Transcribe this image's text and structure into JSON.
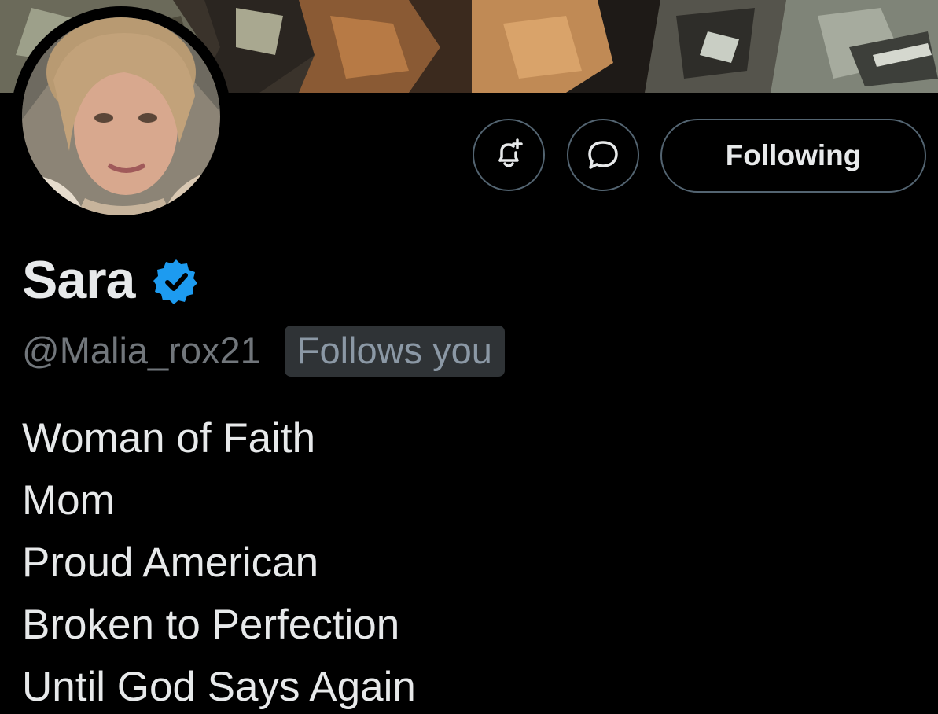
{
  "banner": {
    "image": "rocks-mosaic-banner"
  },
  "profile": {
    "avatar": "profile-photo",
    "name": "Sara",
    "verified_icon": "verified-badge-icon",
    "handle": "@Malia_rox21",
    "follows_you": "Follows you",
    "bio_lines": [
      "Woman of Faith",
      "Mom",
      "Proud American",
      "Broken to Perfection",
      "Until God Says Again"
    ]
  },
  "actions": {
    "notifications_icon": "bell-plus-icon",
    "message_icon": "chat-bubble-icon",
    "follow_label": "Following"
  },
  "colors": {
    "background": "#000000",
    "primary_text": "#e7e9ea",
    "secondary_text": "#71767b",
    "border": "#536471",
    "verified_blue": "#1d9bf0",
    "badge_bg": "#2f3336"
  }
}
